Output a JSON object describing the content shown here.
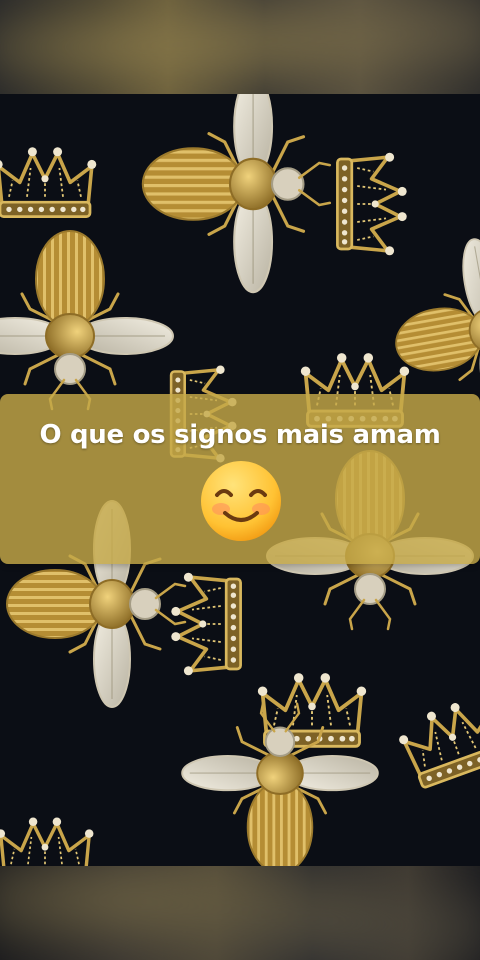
{
  "story": {
    "caption": "O que os signos mais amam",
    "emoji": "smiling-face-with-smiling-eyes-icon"
  },
  "colors": {
    "background": "#0b0e15",
    "caption_overlay": "#c4a848",
    "caption_text": "#ffffff",
    "embroidery_gold": "#c9a54a",
    "embroidery_silver": "#d8d3c4"
  }
}
